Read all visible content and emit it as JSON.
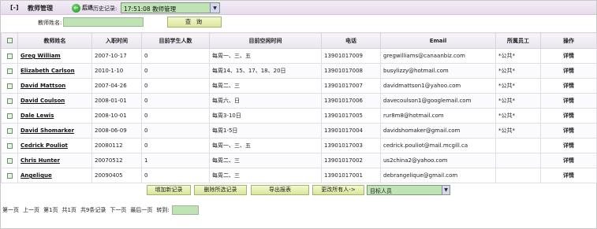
{
  "header": {
    "collapse_label": "[-]",
    "module_title": "教师管理",
    "back_label": "后退",
    "history_label": "历史记录:",
    "history_value": "17:51:08 教师管理"
  },
  "search": {
    "label": "教师姓名:",
    "value": "",
    "button_label": "查 询"
  },
  "table": {
    "columns": [
      "教师姓名",
      "入职时间",
      "目前学生人数",
      "目前空闲时间",
      "电话",
      "Email",
      "所属员工",
      "操作"
    ],
    "rows": [
      {
        "name": "Greg William",
        "hire_date": "2007-10-17",
        "students": "0",
        "free_time": "每周一、三、五",
        "phone": "13901017009",
        "email": "gregwilliams@canaanbiz.com",
        "staff": "*公共*",
        "action": "详情"
      },
      {
        "name": "Elizabeth Carlson",
        "hire_date": "2010-1-10",
        "students": "0",
        "free_time": "每周14、15、17、18、20日",
        "phone": "13901017008",
        "email": "busylizzy@hotmail.com",
        "staff": "*公共*",
        "action": "详情"
      },
      {
        "name": "David Mattson",
        "hire_date": "2007-04-26",
        "students": "0",
        "free_time": "每周二、三",
        "phone": "13901017007",
        "email": "davidmattson1@yahoo.com",
        "staff": "*公共*",
        "action": "详情"
      },
      {
        "name": "David Coulson",
        "hire_date": "2008-01-01",
        "students": "0",
        "free_time": "每周六、日",
        "phone": "13901017006",
        "email": "davecoulson1@googlemail.com",
        "staff": "*公共*",
        "action": "详情"
      },
      {
        "name": "Dale Lewis",
        "hire_date": "2008-10-01",
        "students": "0",
        "free_time": "每周3-10日",
        "phone": "13901017005",
        "email": "rur8m8@hotmail.com",
        "staff": "*公共*",
        "action": "详情"
      },
      {
        "name": "David Shomarker",
        "hire_date": "2008-06-09",
        "students": "0",
        "free_time": "每周1-5日",
        "phone": "13901017004",
        "email": "davidshomaker@gmail.com",
        "staff": "*公共*",
        "action": "详情"
      },
      {
        "name": "Cedrick Pouliot",
        "hire_date": "20080112",
        "students": "0",
        "free_time": "每周一、三、五",
        "phone": "13901017003",
        "email": "cedrick.pouliot@mail.mcgill.ca",
        "staff": "",
        "action": "详情"
      },
      {
        "name": "Chris Hunter",
        "hire_date": "20070512",
        "students": "1",
        "free_time": "每周二、三",
        "phone": "13901017002",
        "email": "us2china2@yahoo.com",
        "staff": "",
        "action": "详情"
      },
      {
        "name": "Angelique",
        "hire_date": "20090405",
        "students": "0",
        "free_time": "每周二、三",
        "phone": "13901017001",
        "email": "debrangelique@gmail.com",
        "staff": "",
        "action": "详情"
      }
    ]
  },
  "actions": {
    "add_label": "增加新记录",
    "delete_label": "删除所选记录",
    "export_label": "导出报表",
    "change_all_label": "更改所有人->",
    "target_select_value": "目标人员"
  },
  "pagination": {
    "first": "第一页",
    "prev_top": "上一页",
    "page": "第1页",
    "total_pages": "共1页",
    "total_records": "共9条记录",
    "next": "下一页",
    "last": "最后一页",
    "goto_label": "转到:",
    "goto_value": ""
  },
  "colors": {
    "input_bg": "#bfe3b5",
    "button_bg": "#dbe69a",
    "titlebar_bg": "#e7dcee"
  }
}
